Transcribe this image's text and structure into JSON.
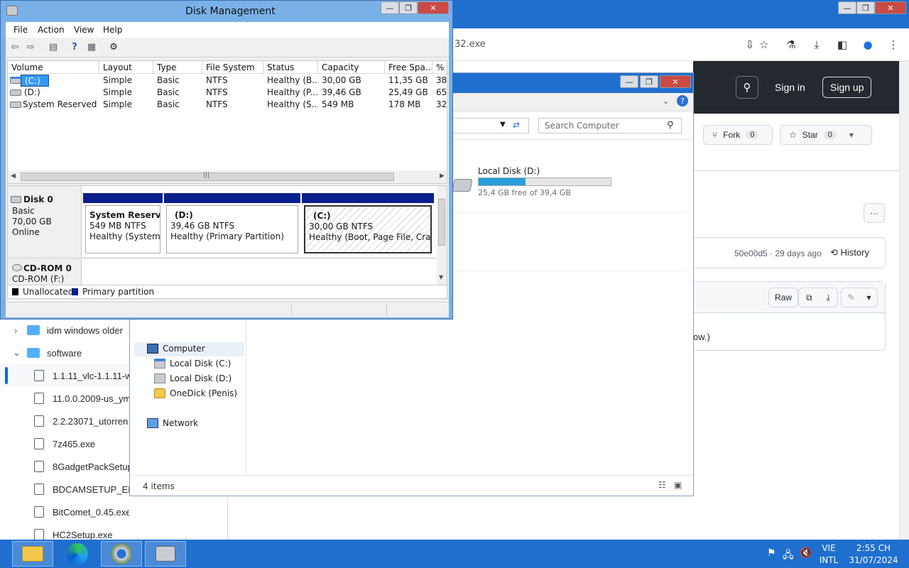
{
  "browser": {
    "address_fragment": "32.exe",
    "sign_in": "Sign in",
    "sign_up": "Sign up",
    "fork_label": "Fork",
    "fork_count": "0",
    "star_label": "Star",
    "star_count": "0",
    "commit_info": "50e00d5 · 29 days ago",
    "history_label": "History",
    "raw_label": "Raw",
    "content_fragment": "ow.)",
    "tree": [
      {
        "type": "folder",
        "label": "idm windows older",
        "expanded": false
      },
      {
        "type": "folder",
        "label": "software",
        "expanded": true
      },
      {
        "type": "file",
        "label": "1.1.11_vlc-1.1.11-w",
        "selected": true
      },
      {
        "type": "file",
        "label": "11.0.0.2009-us_ym"
      },
      {
        "type": "file",
        "label": "2.2.23071_utorren"
      },
      {
        "type": "file",
        "label": "7z465.exe"
      },
      {
        "type": "file",
        "label": "8GadgetPackSetup"
      },
      {
        "type": "file",
        "label": "BDCAMSETUP_EN"
      },
      {
        "type": "file",
        "label": "BitComet_0.45.exe"
      },
      {
        "type": "file",
        "label": "HC2Setup.exe"
      }
    ]
  },
  "explorer": {
    "search_placeholder": "Search Computer",
    "drive_d_label": "Local Disk (D:)",
    "drive_d_free": "25,4 GB free of 39,4 GB",
    "drive_d_used_fraction": 0.355,
    "nav": {
      "computer": "Computer",
      "local_c": "Local Disk (C:)",
      "local_d": "Local Disk (D:)",
      "onedick": "OneDick (Penis)",
      "network": "Network"
    },
    "status": "4 items"
  },
  "disk_mgmt": {
    "title": "Disk Management",
    "menu": [
      "File",
      "Action",
      "View",
      "Help"
    ],
    "columns": [
      "Volume",
      "Layout",
      "Type",
      "File System",
      "Status",
      "Capacity",
      "Free Spa...",
      "% F"
    ],
    "rows": [
      [
        "(C:)",
        "Simple",
        "Basic",
        "NTFS",
        "Healthy (B...",
        "30,00 GB",
        "11,35 GB",
        "38"
      ],
      [
        "(D:)",
        "Simple",
        "Basic",
        "NTFS",
        "Healthy (P...",
        "39,46 GB",
        "25,49 GB",
        "65"
      ],
      [
        "System Reserved",
        "Simple",
        "Basic",
        "NTFS",
        "Healthy (S...",
        "549 MB",
        "178 MB",
        "32"
      ]
    ],
    "disk0": {
      "name": "Disk 0",
      "kind": "Basic",
      "size": "70,00 GB",
      "state": "Online",
      "partitions": [
        {
          "name": "System Reserved",
          "size": "549 MB NTFS",
          "status": "Healthy (System, A"
        },
        {
          "name": "(D:)",
          "size": "39,46 GB NTFS",
          "status": "Healthy (Primary Partition)"
        },
        {
          "name": "(C:)",
          "size": "30,00 GB NTFS",
          "status": "Healthy (Boot, Page File, Crash D"
        }
      ]
    },
    "cdrom": {
      "name": "CD-ROM 0",
      "drive": "CD-ROM (F:)"
    },
    "legend": {
      "unallocated": "Unallocated",
      "primary": "Primary partition"
    }
  },
  "taskbar": {
    "lang_top": "VIE",
    "lang_bottom": "INTL",
    "time": "2:55 CH",
    "date": "31/07/2024"
  },
  "colors": {
    "taskbar": "#1f6fcf",
    "partition_bar": "#0a1f8c",
    "github_header": "#24292f"
  }
}
